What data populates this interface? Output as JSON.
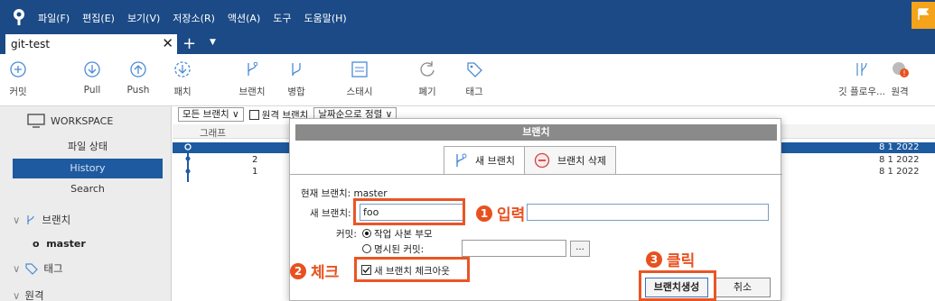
{
  "menu": [
    "파일(F)",
    "편집(E)",
    "보기(V)",
    "저장소(R)",
    "액션(A)",
    "도구",
    "도움말(H)"
  ],
  "tab": {
    "label": "git-test",
    "close": "✕",
    "add": "+",
    "dropdown": "▼"
  },
  "toolbar": [
    {
      "label": "커밋",
      "icon": "commit-icon"
    },
    {
      "label": "Pull",
      "icon": "pull-icon"
    },
    {
      "label": "Push",
      "icon": "push-icon"
    },
    {
      "label": "패치",
      "icon": "fetch-icon"
    },
    {
      "label": "브랜치",
      "icon": "branch-icon"
    },
    {
      "label": "병합",
      "icon": "merge-icon"
    },
    {
      "label": "스태시",
      "icon": "stash-icon"
    },
    {
      "label": "폐기",
      "icon": "discard-icon"
    },
    {
      "label": "태그",
      "icon": "tag-icon"
    },
    {
      "label": "깃 플로우...",
      "icon": "git-flow-icon"
    },
    {
      "label": "원격",
      "icon": "remote-icon"
    }
  ],
  "sidebar": {
    "workspace": "WORKSPACE",
    "items": [
      "파일 상태",
      "History",
      "Search"
    ],
    "branches": "브랜치",
    "master": "master",
    "tags": "태그",
    "remote": "원격"
  },
  "filter": {
    "branches": "모든 브랜치",
    "original_branch": "원격 브랜치",
    "sort": "날짜순으로 정렬"
  },
  "graph": {
    "header": "그래프",
    "rows": [
      "2",
      "1"
    ],
    "dates": [
      "8 1 2022",
      "8 1 2022",
      "8 1 2022"
    ]
  },
  "dialog": {
    "title": "브랜치",
    "tab_new": "새 브랜치",
    "tab_delete": "브랜치 삭제",
    "current_branch_label": "현재 브랜치:",
    "current_branch_value": "master",
    "new_branch_label": "새 브랜치:",
    "new_branch_value": "foo",
    "commit_label": "커밋:",
    "radio_parent": "작업 사본 부모",
    "radio_specific": "명시된 커밋:",
    "browse": "...",
    "checkout": "새 브랜치 체크아웃",
    "create_button": "브랜치생성",
    "cancel_button": "취소"
  },
  "annotations": {
    "one": "1",
    "one_text": "입력",
    "two": "2",
    "two_text": "체크",
    "three": "3",
    "three_text": "클릭"
  },
  "colors": {
    "titlebar": "#1b4a86",
    "accent": "#e8511f",
    "selection": "#1e5aa0"
  }
}
